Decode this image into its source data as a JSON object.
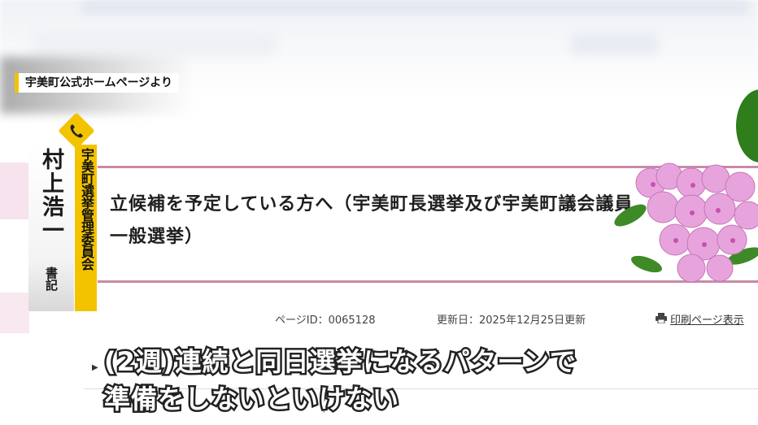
{
  "source_caption": "宇美町公式ホームページより",
  "speaker": {
    "name": "村上浩一",
    "title": "書記",
    "organization": "宇美町選挙管理委員会",
    "icon": "phone-icon"
  },
  "page": {
    "heading": "立候補を予定している方へ（宇美町長選挙及び宇美町議会議員一般選挙）",
    "page_id": "ページID：0065128",
    "updated": "更新日：2025年12月25日更新",
    "print_label": "印刷ページ表示",
    "print_icon": "printer-icon"
  },
  "subtitle": {
    "line1": "(2週)連続と同日選挙になるパターンで",
    "line2": "準備をしないといけない"
  },
  "colors": {
    "accent_yellow": "#f3c300",
    "heading_border": "#c98aa6",
    "flower_pink": "#d77fc0"
  }
}
